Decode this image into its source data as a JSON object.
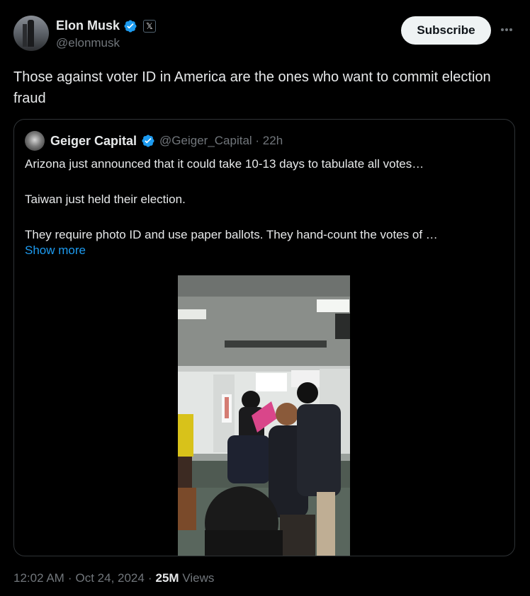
{
  "author": {
    "display_name": "Elon Musk",
    "handle": "@elonmusk",
    "affiliate_badge": "𝕏",
    "verified_icon": "verified-badge-icon"
  },
  "actions": {
    "subscribe_label": "Subscribe",
    "more_icon": "more-horizontal-icon"
  },
  "tweet": {
    "text": "Those against voter ID in America are the ones who want to commit election fraud"
  },
  "quoted": {
    "display_name": "Geiger Capital",
    "handle_time": "@Geiger_Capital · 22h",
    "lines": [
      "Arizona just announced that it could take 10-13 days to tabulate all votes…",
      "Taiwan just held their election.",
      "They require photo ID and use paper ballots. They hand-count the votes of …"
    ],
    "show_more": "Show more",
    "media_type": "video"
  },
  "meta": {
    "time": "12:02 AM",
    "dot1": "·",
    "date": "Oct 24, 2024",
    "dot2": "·",
    "views": "25M",
    "views_label": "Views"
  },
  "colors": {
    "background": "#000000",
    "text": "#e7e9ea",
    "muted": "#71767b",
    "link": "#1d9bf0",
    "verified": "#1d9bf0",
    "border": "#2f3336"
  }
}
